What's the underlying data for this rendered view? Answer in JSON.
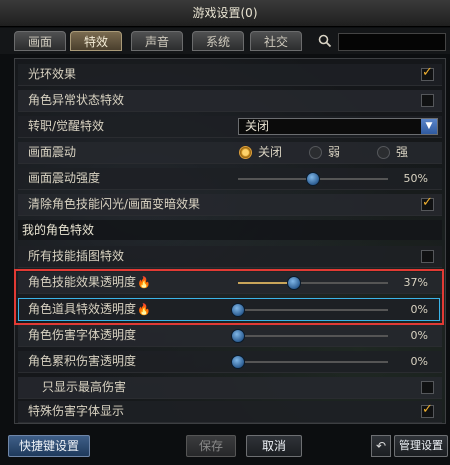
{
  "window": {
    "title": "游戏设置(0)"
  },
  "tabs": [
    {
      "label": "画面",
      "active": false
    },
    {
      "label": "特效",
      "active": true
    },
    {
      "label": "声音",
      "active": false
    },
    {
      "label": "系统",
      "active": false
    },
    {
      "label": "社交",
      "active": false
    }
  ],
  "search": {
    "icon": "magnifier-icon",
    "value": ""
  },
  "settings": {
    "aura": {
      "label": "光环效果",
      "checked": true
    },
    "abnormal": {
      "label": "角色异常状态特效",
      "checked": false
    },
    "awaken": {
      "label": "转职/觉醒特效",
      "value": "关闭"
    },
    "shake": {
      "label": "画面震动",
      "options": [
        "关闭",
        "弱",
        "强"
      ],
      "selected": "关闭"
    },
    "shake_strength": {
      "label": "画面震动强度",
      "value_pct": 50,
      "display": "50%"
    },
    "clear_flash": {
      "label": "清除角色技能闪光/画面变暗效果",
      "checked": true
    },
    "section_my_char": "我的角色特效",
    "all_skill_art": {
      "label": "所有技能插图特效",
      "checked": false
    },
    "skill_alpha": {
      "label": "角色技能效果透明度",
      "value_pct": 37,
      "display": "37%"
    },
    "item_alpha": {
      "label": "角色道具特效透明度",
      "value_pct": 0,
      "display": "0%"
    },
    "dmg_font_alpha": {
      "label": "角色伤害字体透明度",
      "value_pct": 0,
      "display": "0%"
    },
    "accum_dmg_alpha": {
      "label": "角色累积伤害透明度",
      "value_pct": 0,
      "display": "0%"
    },
    "max_dmg_only": {
      "label": "只显示最高伤害",
      "checked": false
    },
    "special_dmg_font": {
      "label": "特殊伤害字体显示",
      "checked": true
    }
  },
  "footer": {
    "shortcut": "快捷键设置",
    "save": "保存",
    "cancel": "取消",
    "manage": "管理设置",
    "reset_icon": "undo-icon"
  },
  "colors": {
    "highlight_red": "#e23a34",
    "highlight_blue": "#3bb4e8",
    "accent_orange": "#f0b030"
  }
}
